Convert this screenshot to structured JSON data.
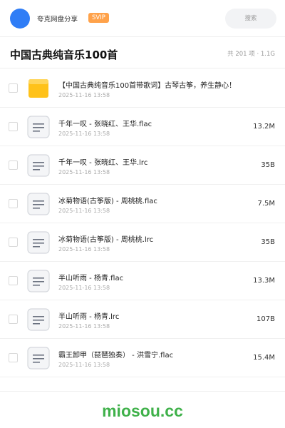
{
  "header": {
    "user_name": "夸克网盘分享",
    "badge": "SVIP",
    "search_placeholder": "搜索"
  },
  "folder": {
    "title": "中国古典纯音乐100首",
    "meta": "共 201 项 · 1.1G"
  },
  "colors": {
    "avatar": "#2f7df6",
    "badge": "#ffa24a",
    "folder_icon": "#ffc21a",
    "logo": "#3fb14a"
  },
  "files": [
    {
      "icon": "folder-icon",
      "name": "【中国古典纯音乐100首带歌词】古琴古筝，养生静心！",
      "date": "2025-11-16 13:58",
      "size": ""
    },
    {
      "icon": "document-icon",
      "name": "千年一叹 - 张晓红、王华.flac",
      "date": "2025-11-16 13:58",
      "size": "13.2M"
    },
    {
      "icon": "document-icon",
      "name": "千年一叹 - 张晓红、王华.lrc",
      "date": "2025-11-16 13:58",
      "size": "35B"
    },
    {
      "icon": "document-icon",
      "name": "冰菊物语(古筝版) - 周桃桃.flac",
      "date": "2025-11-16 13:58",
      "size": "7.5M"
    },
    {
      "icon": "document-icon",
      "name": "冰菊物语(古筝版) - 周桃桃.lrc",
      "date": "2025-11-16 13:58",
      "size": "35B"
    },
    {
      "icon": "document-icon",
      "name": "半山听雨 - 杨青.flac",
      "date": "2025-11-16 13:58",
      "size": "13.3M"
    },
    {
      "icon": "document-icon",
      "name": "半山听雨 - 杨青.lrc",
      "date": "2025-11-16 13:58",
      "size": "107B"
    },
    {
      "icon": "document-icon",
      "name": "霸王卸甲（琵琶独奏） - 洪雪宁.flac",
      "date": "2025-11-16 13:58",
      "size": "15.4M"
    }
  ],
  "footer": {
    "logo_text": "miosou.cc"
  }
}
